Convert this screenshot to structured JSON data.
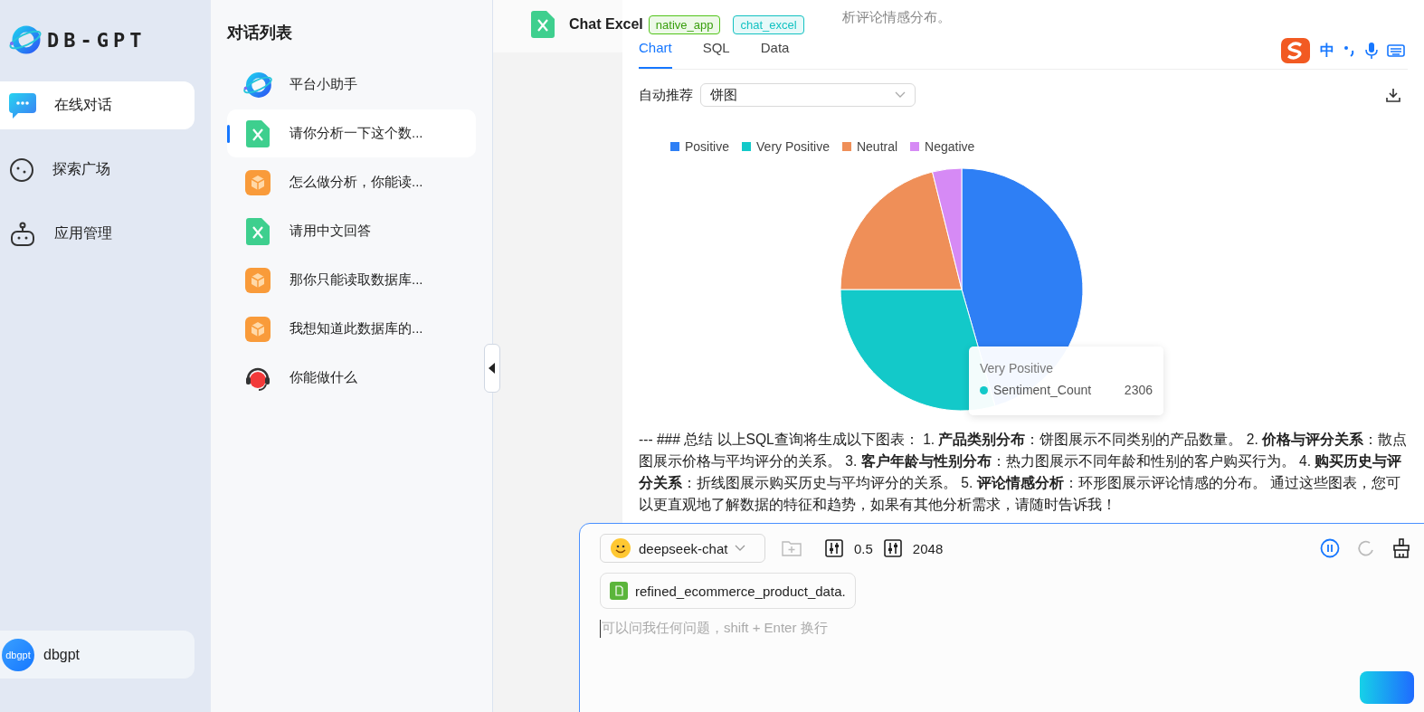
{
  "sidebar": {
    "logo_text": "DB-GPT",
    "nav": [
      {
        "label": "在线对话",
        "kind": "chat",
        "selected": true
      },
      {
        "label": "探索广场",
        "kind": "explore",
        "selected": false
      },
      {
        "label": "应用管理",
        "kind": "apps",
        "selected": false
      }
    ],
    "user": {
      "avatar": "dbgpt",
      "name": "dbgpt"
    }
  },
  "conversations": {
    "title": "对话列表",
    "items": [
      {
        "label": "平台小助手",
        "kind": "logo",
        "selected": false
      },
      {
        "label": "请你分析一下这个数...",
        "kind": "excel",
        "selected": true
      },
      {
        "label": "怎么做分析，你能读...",
        "kind": "app",
        "selected": false
      },
      {
        "label": "请用中文回答",
        "kind": "excel",
        "selected": false
      },
      {
        "label": "那你只能读取数据库...",
        "kind": "app",
        "selected": false
      },
      {
        "label": "我想知道此数据库的...",
        "kind": "app",
        "selected": false
      },
      {
        "label": "你能做什么",
        "kind": "robot",
        "selected": false
      }
    ]
  },
  "header": {
    "title": "Chat Excel",
    "tags": [
      {
        "label": "native_app",
        "color": "#52c41a"
      },
      {
        "label": "chat_excel",
        "color": "#13c2c2"
      }
    ]
  },
  "message": {
    "top_text": "析评论情感分布。",
    "tabs": [
      {
        "label": "Chart",
        "selected": true
      },
      {
        "label": "SQL",
        "selected": false
      },
      {
        "label": "Data",
        "selected": false
      }
    ],
    "recommend_label": "自动推荐",
    "chart_type": "饼图",
    "legend": [
      {
        "label": "Positive",
        "color": "#2e7ff5"
      },
      {
        "label": "Very Positive",
        "color": "#13c9c9"
      },
      {
        "label": "Neutral",
        "color": "#ef8f58"
      },
      {
        "label": "Negative",
        "color": "#d68af5"
      }
    ],
    "tooltip": {
      "title": "Very Positive",
      "series": "Sentiment_Count",
      "value": "2306",
      "color": "#13c9c9"
    },
    "summary": "--- ### 总结 以上SQL查询将生成以下图表： 1. **产品类别分布**：饼图展示不同类别的产品数量。 2. **价格与评分关系**：散点图展示价格与平均评分的关系。 3. **客户年龄与性别分布**：热力图展示不同年龄和性别的客户购买行为。 4. **购买历史与评分关系**：折线图展示购买历史与平均评分的关系。 5. **评论情感分析**：环形图展示评论情感的分布。 通过这些图表，您可以更直观地了解数据的特征和趋势，如果有其他分析需求，请随时告诉我！"
  },
  "ime": {
    "label": "中"
  },
  "input": {
    "model": "deepseek-chat",
    "temperature": "0.5",
    "max_tokens": "2048",
    "file": "refined_ecommerce_product_data.",
    "placeholder": "可以问我任何问题，shift + Enter 换行"
  }
}
